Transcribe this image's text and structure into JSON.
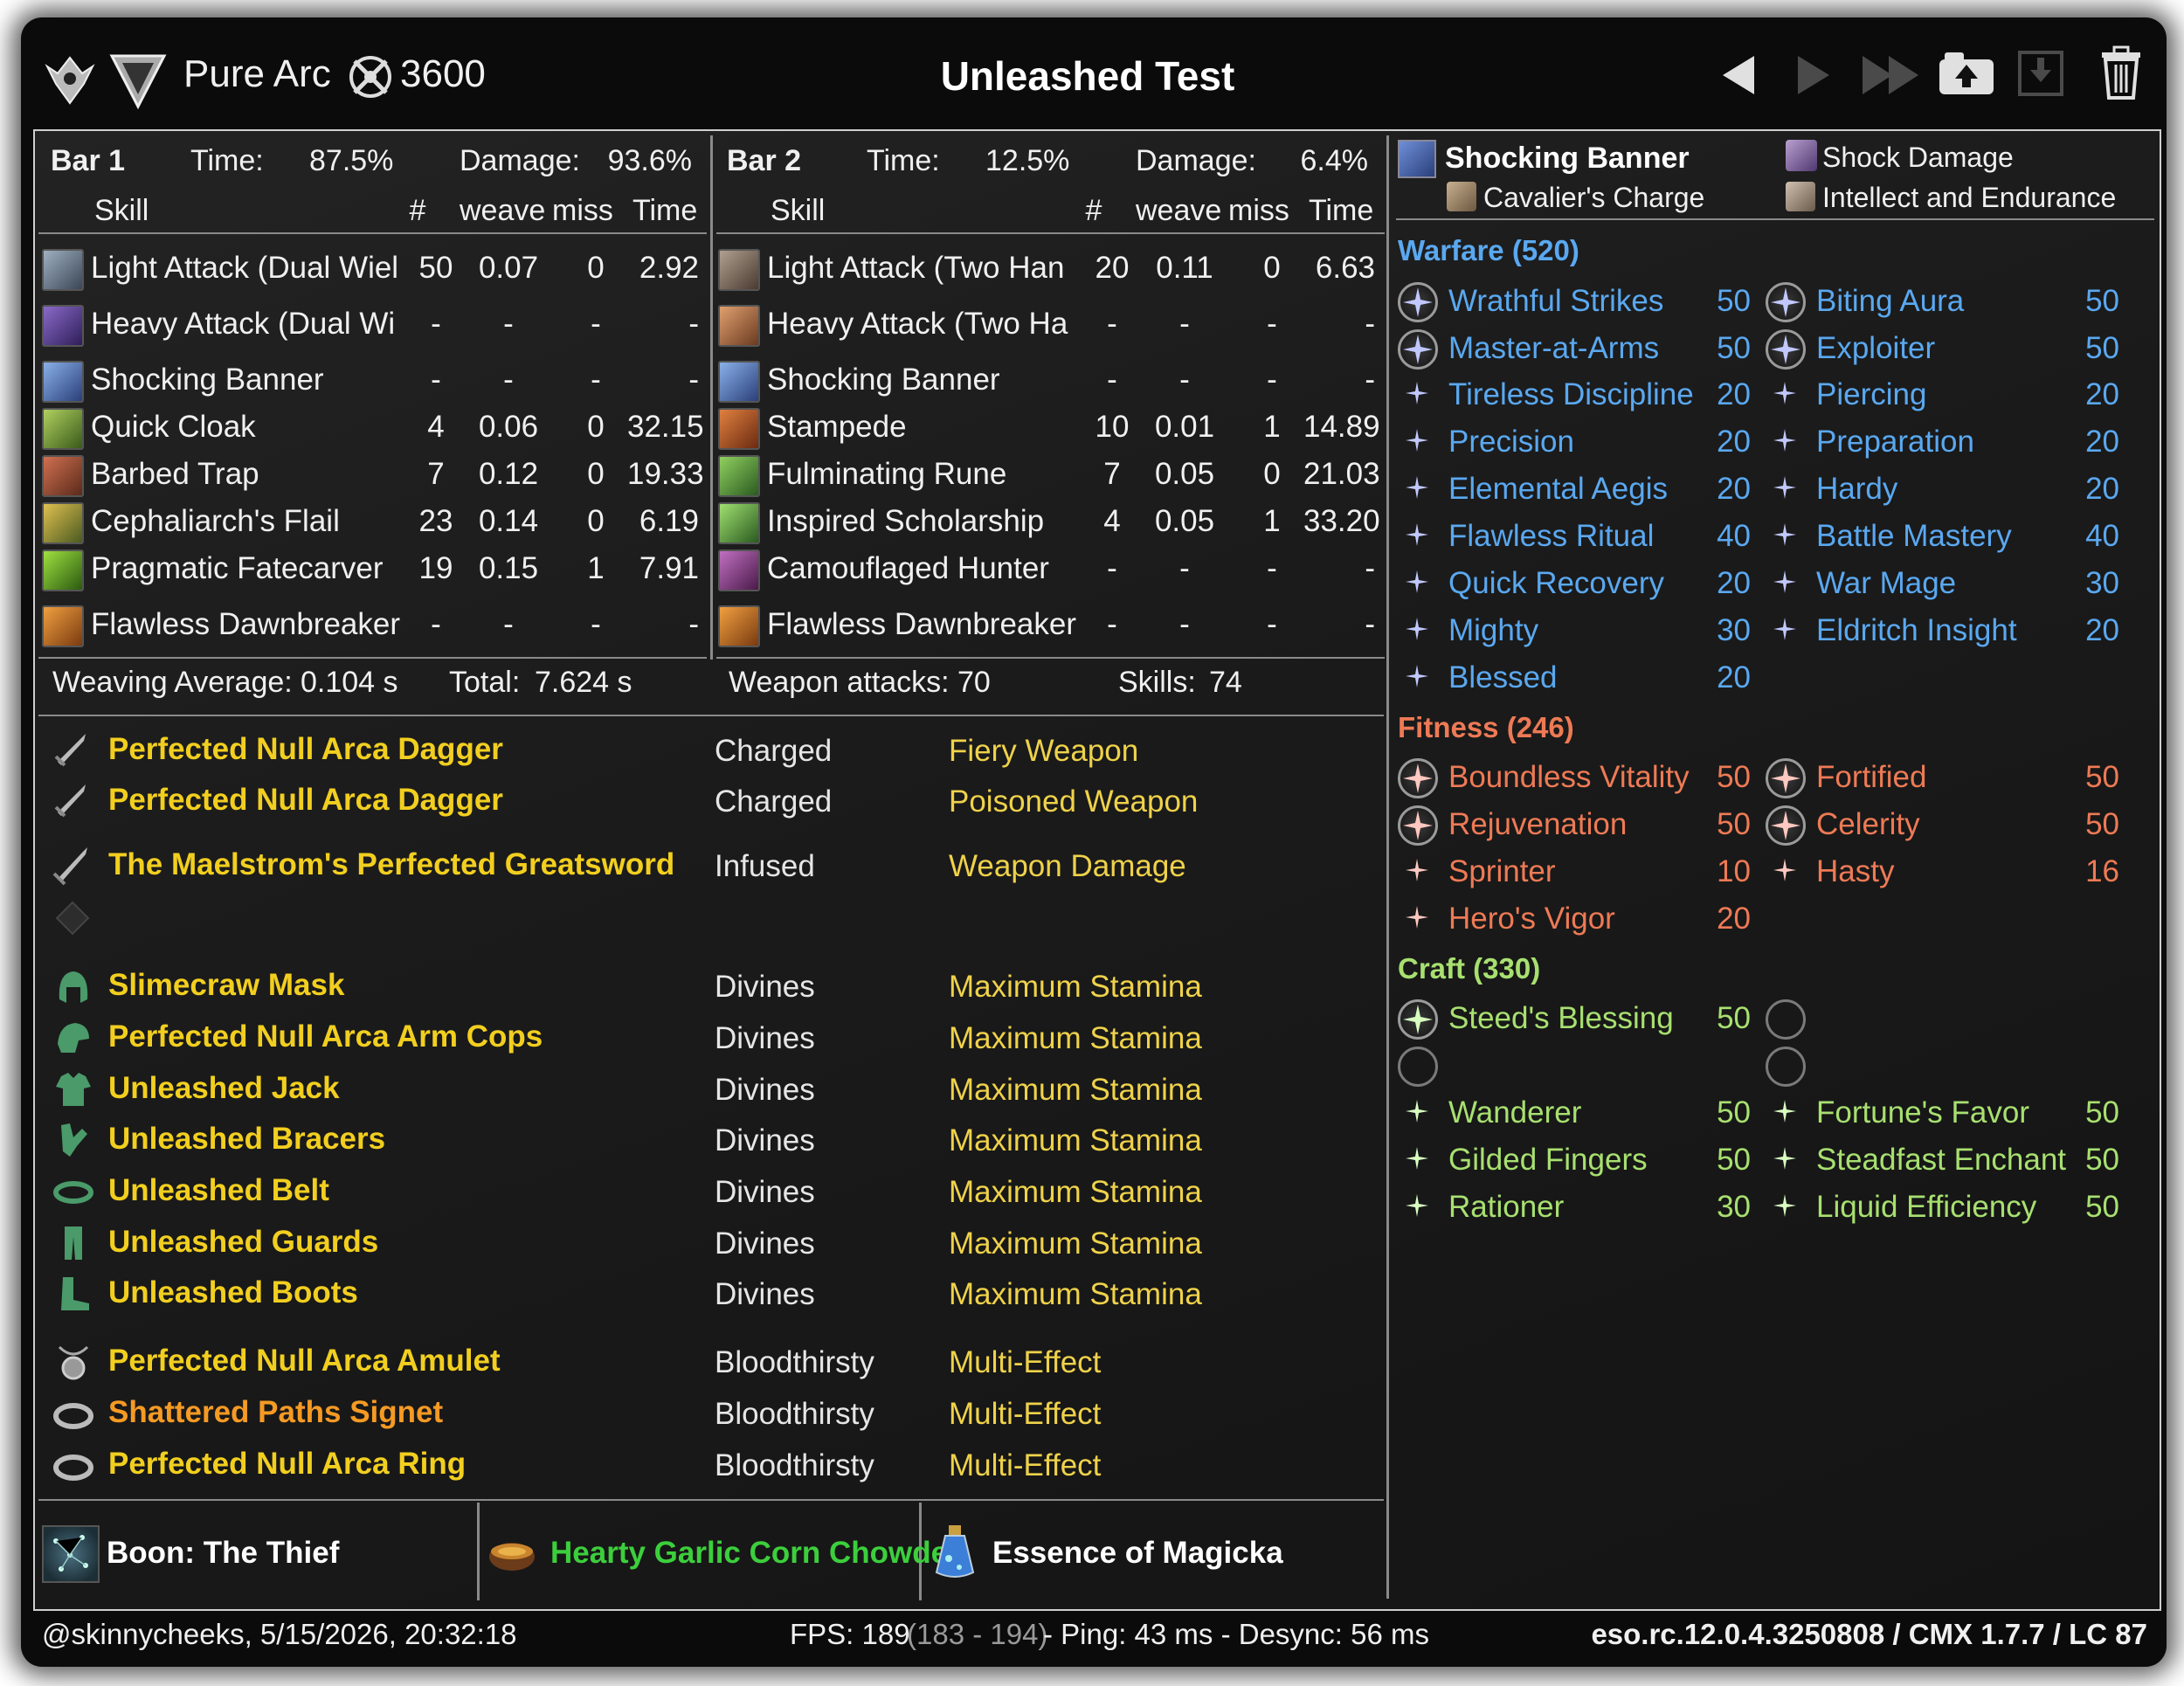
{
  "header": {
    "build_name": "Pure Arc",
    "cp_total": "3600",
    "title": "Unleashed Test"
  },
  "colors": {
    "gold": "#f2cf1f",
    "orange": "#f59a23",
    "warfare": "#5aa8f0",
    "fitness": "#ee7a55",
    "craft": "#a8e070",
    "food_green": "#3ccf3c"
  },
  "bar1": {
    "label": "Bar 1",
    "time_label": "Time:",
    "time_value": "87.5%",
    "damage_label": "Damage:",
    "damage_value": "93.6%",
    "cols": {
      "skill": "Skill",
      "count": "#",
      "weave": "weave",
      "miss": "miss",
      "time": "Time"
    },
    "rows": [
      {
        "skill": "Light Attack (Dual Wiel",
        "count": "50",
        "weave": "0.07",
        "miss": "0",
        "time": "2.92",
        "icon": "light-attack-dual-icon"
      },
      {
        "skill": "Heavy Attack (Dual Wi",
        "count": "-",
        "weave": "-",
        "miss": "-",
        "time": "-",
        "icon": "heavy-attack-dual-icon"
      },
      {
        "skill": "Shocking Banner",
        "count": "-",
        "weave": "-",
        "miss": "-",
        "time": "-",
        "icon": "shocking-banner-icon"
      },
      {
        "skill": "Quick Cloak",
        "count": "4",
        "weave": "0.06",
        "miss": "0",
        "time": "32.15",
        "icon": "quick-cloak-icon"
      },
      {
        "skill": "Barbed Trap",
        "count": "7",
        "weave": "0.12",
        "miss": "0",
        "time": "19.33",
        "icon": "barbed-trap-icon"
      },
      {
        "skill": "Cephaliarch's Flail",
        "count": "23",
        "weave": "0.14",
        "miss": "0",
        "time": "6.19",
        "icon": "cephaliarch-flail-icon"
      },
      {
        "skill": "Pragmatic Fatecarver",
        "count": "19",
        "weave": "0.15",
        "miss": "1",
        "time": "7.91",
        "icon": "fatecarver-icon"
      },
      {
        "skill": "Flawless Dawnbreaker",
        "count": "-",
        "weave": "-",
        "miss": "-",
        "time": "-",
        "icon": "dawnbreaker-icon"
      }
    ]
  },
  "bar2": {
    "label": "Bar 2",
    "time_label": "Time:",
    "time_value": "12.5%",
    "damage_label": "Damage:",
    "damage_value": "6.4%",
    "cols": {
      "skill": "Skill",
      "count": "#",
      "weave": "weave",
      "miss": "miss",
      "time": "Time"
    },
    "rows": [
      {
        "skill": "Light Attack (Two Han",
        "count": "20",
        "weave": "0.11",
        "miss": "0",
        "time": "6.63",
        "icon": "light-attack-2h-icon"
      },
      {
        "skill": "Heavy Attack (Two Ha",
        "count": "-",
        "weave": "-",
        "miss": "-",
        "time": "-",
        "icon": "heavy-attack-2h-icon"
      },
      {
        "skill": "Shocking Banner",
        "count": "-",
        "weave": "-",
        "miss": "-",
        "time": "-",
        "icon": "shocking-banner-icon"
      },
      {
        "skill": "Stampede",
        "count": "10",
        "weave": "0.01",
        "miss": "1",
        "time": "14.89",
        "icon": "stampede-icon"
      },
      {
        "skill": "Fulminating Rune",
        "count": "7",
        "weave": "0.05",
        "miss": "0",
        "time": "21.03",
        "icon": "fulminating-rune-icon"
      },
      {
        "skill": "Inspired Scholarship",
        "count": "4",
        "weave": "0.05",
        "miss": "1",
        "time": "33.20",
        "icon": "scholarship-icon"
      },
      {
        "skill": "Camouflaged Hunter",
        "count": "-",
        "weave": "-",
        "miss": "-",
        "time": "-",
        "icon": "camouflaged-hunter-icon"
      },
      {
        "skill": "Flawless Dawnbreaker",
        "count": "-",
        "weave": "-",
        "miss": "-",
        "time": "-",
        "icon": "dawnbreaker-icon"
      }
    ]
  },
  "stats": {
    "weaving_label": "Weaving Average:",
    "weaving_value": "0.104 s",
    "total_label": "Total:",
    "total_value": "7.624 s",
    "weapon_label": "Weapon attacks:",
    "weapon_value": "70",
    "skills_label": "Skills:",
    "skills_value": "74"
  },
  "gear": [
    {
      "name": "Perfected Null Arca Dagger",
      "trait": "Charged",
      "enchant": "Fiery Weapon",
      "quality": "gold",
      "icon": "dagger-icon"
    },
    {
      "name": "Perfected Null Arca Dagger",
      "trait": "Charged",
      "enchant": "Poisoned Weapon",
      "quality": "gold",
      "icon": "dagger-icon"
    },
    {
      "name": "The Maelstrom's Perfected Greatsword",
      "trait": "Infused",
      "enchant": "Weapon Damage",
      "quality": "gold",
      "icon": "greatsword-icon"
    },
    {
      "name": "Slimecraw Mask",
      "trait": "Divines",
      "enchant": "Maximum Stamina",
      "quality": "gold",
      "icon": "head-icon"
    },
    {
      "name": "Perfected Null Arca Arm Cops",
      "trait": "Divines",
      "enchant": "Maximum Stamina",
      "quality": "gold",
      "icon": "shoulder-icon"
    },
    {
      "name": "Unleashed Jack",
      "trait": "Divines",
      "enchant": "Maximum Stamina",
      "quality": "gold",
      "icon": "chest-icon"
    },
    {
      "name": "Unleashed Bracers",
      "trait": "Divines",
      "enchant": "Maximum Stamina",
      "quality": "gold",
      "icon": "hands-icon"
    },
    {
      "name": "Unleashed Belt",
      "trait": "Divines",
      "enchant": "Maximum Stamina",
      "quality": "gold",
      "icon": "belt-icon"
    },
    {
      "name": "Unleashed Guards",
      "trait": "Divines",
      "enchant": "Maximum Stamina",
      "quality": "gold",
      "icon": "legs-icon"
    },
    {
      "name": "Unleashed Boots",
      "trait": "Divines",
      "enchant": "Maximum Stamina",
      "quality": "gold",
      "icon": "feet-icon"
    },
    {
      "name": "Perfected Null Arca Amulet",
      "trait": "Bloodthirsty",
      "enchant": "Multi-Effect",
      "quality": "gold",
      "icon": "amulet-icon"
    },
    {
      "name": "Shattered Paths Signet",
      "trait": "Bloodthirsty",
      "enchant": "Multi-Effect",
      "quality": "orange",
      "icon": "ring-icon"
    },
    {
      "name": "Perfected Null Arca Ring",
      "trait": "Bloodthirsty",
      "enchant": "Multi-Effect",
      "quality": "gold",
      "icon": "ring-icon"
    }
  ],
  "footer_panel": {
    "mundus": "Boon: The Thief",
    "food": "Hearty Garlic Corn Chowder",
    "potion": "Essence of Magicka"
  },
  "champion": {
    "top": {
      "left_title": "Shocking Banner",
      "left_sub": "Cavalier's Charge",
      "right_title": "Shock Damage",
      "right_sub": "Intellect and Endurance"
    },
    "warfare": {
      "header": "Warfare (520)",
      "left": [
        {
          "name": "Wrathful Strikes",
          "value": "50",
          "slotted": true
        },
        {
          "name": "Master-at-Arms",
          "value": "50",
          "slotted": true
        },
        {
          "name": "Tireless Discipline",
          "value": "20",
          "slotted": false
        },
        {
          "name": "Precision",
          "value": "20",
          "slotted": false
        },
        {
          "name": "Elemental Aegis",
          "value": "20",
          "slotted": false
        },
        {
          "name": "Flawless Ritual",
          "value": "40",
          "slotted": false
        },
        {
          "name": "Quick Recovery",
          "value": "20",
          "slotted": false
        },
        {
          "name": "Mighty",
          "value": "30",
          "slotted": false
        },
        {
          "name": "Blessed",
          "value": "20",
          "slotted": false
        }
      ],
      "right": [
        {
          "name": "Biting Aura",
          "value": "50",
          "slotted": true
        },
        {
          "name": "Exploiter",
          "value": "50",
          "slotted": true
        },
        {
          "name": "Piercing",
          "value": "20",
          "slotted": false
        },
        {
          "name": "Preparation",
          "value": "20",
          "slotted": false
        },
        {
          "name": "Hardy",
          "value": "20",
          "slotted": false
        },
        {
          "name": "Battle Mastery",
          "value": "40",
          "slotted": false
        },
        {
          "name": "War Mage",
          "value": "30",
          "slotted": false
        },
        {
          "name": "Eldritch Insight",
          "value": "20",
          "slotted": false
        }
      ]
    },
    "fitness": {
      "header": "Fitness (246)",
      "left": [
        {
          "name": "Boundless Vitality",
          "value": "50",
          "slotted": true
        },
        {
          "name": "Rejuvenation",
          "value": "50",
          "slotted": true
        },
        {
          "name": "Sprinter",
          "value": "10",
          "slotted": false
        },
        {
          "name": "Hero's Vigor",
          "value": "20",
          "slotted": false
        }
      ],
      "right": [
        {
          "name": "Fortified",
          "value": "50",
          "slotted": true
        },
        {
          "name": "Celerity",
          "value": "50",
          "slotted": true
        },
        {
          "name": "Hasty",
          "value": "16",
          "slotted": false
        }
      ]
    },
    "craft": {
      "header": "Craft (330)",
      "left": [
        {
          "name": "Steed's Blessing",
          "value": "50",
          "slotted": true
        },
        {
          "name": "Wanderer",
          "value": "50",
          "slotted": false
        },
        {
          "name": "Gilded Fingers",
          "value": "50",
          "slotted": false
        },
        {
          "name": "Rationer",
          "value": "30",
          "slotted": false
        }
      ],
      "right": [
        {
          "name": "Fortune's Favor",
          "value": "50",
          "slotted": false
        },
        {
          "name": "Steadfast Enchant",
          "value": "50",
          "slotted": false
        },
        {
          "name": "Liquid Efficiency",
          "value": "50",
          "slotted": false
        }
      ]
    }
  },
  "statusbar": {
    "user_time": "@skinnycheeks, 5/15/2026, 20:32:18",
    "fps": "FPS: 189",
    "fps_range": "(183 - 194)",
    "ping": "- Ping: 43 ms - Desync: 56 ms",
    "version": "eso.rc.12.0.4.3250808 / CMX 1.7.7 / LC 87"
  }
}
